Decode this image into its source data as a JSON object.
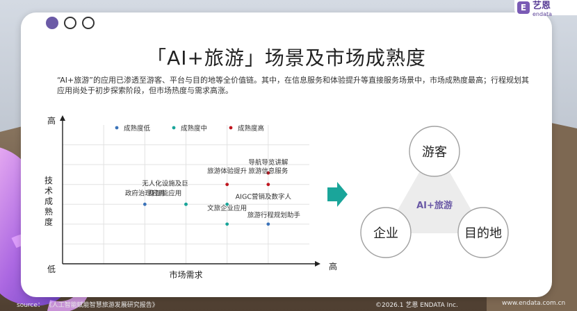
{
  "header": {
    "title": "「AI+旅游」场景及市场成熟度",
    "description": "“AI+旅游”的应用已渗透至游客、平台与目的地等全价值链。其中，在信息服务和体验提升等直接服务场景中，市场成熟度最高；行程规划其应用尚处于初步探索阶段，但市场热度与需求高涨。"
  },
  "logo": {
    "mark": "E",
    "name": "艺恩",
    "sub": "endata"
  },
  "colors": {
    "low": "#3b73b9",
    "mid": "#1aa59a",
    "high": "#c0161f",
    "arrow": "#1aa59a",
    "venn": "#a0a0a0",
    "accent": "#6b5aa6"
  },
  "chart_data": {
    "type": "scatter",
    "xlabel": "市场需求",
    "ylabel": "技术成熟度",
    "x_high_label": "高",
    "y_high_label": "高",
    "origin_label": "低",
    "xlim": [
      0,
      6
    ],
    "ylim": [
      0,
      7
    ],
    "grid": true,
    "legend_position": "top",
    "series": [
      {
        "name": "成熟度低",
        "color_key": "low",
        "points": [
          {
            "label": "政府治理应用",
            "x": 2,
            "y": 3
          },
          {
            "label": "旅游行程规划助手",
            "x": 5,
            "y": 2
          }
        ]
      },
      {
        "name": "成熟度中",
        "color_key": "mid",
        "points": [
          {
            "label": "无人化设施及巨",
            "x": 3,
            "y": 3
          },
          {
            "label": "AIGC营销及数字人",
            "x": 4,
            "y": 3
          },
          {
            "label": "身智能应用",
            "x": 3,
            "y": 3
          },
          {
            "label": "文旅企业应用",
            "x": 4,
            "y": 2
          }
        ]
      },
      {
        "name": "成熟度高",
        "color_key": "high",
        "points": [
          {
            "label": "导航导览讲解",
            "x": 5,
            "y": 5
          },
          {
            "label": "旅游体验提升",
            "x": 4,
            "y": 4
          },
          {
            "label": "旅游信息服务",
            "x": 5,
            "y": 4
          }
        ]
      }
    ]
  },
  "venn": {
    "top": "游客",
    "left": "企业",
    "right": "目的地",
    "center": "AI+旅游"
  },
  "footer": {
    "source": "source： 《人工智能赋能智慧旅游发展研究报告》",
    "copyright": "©2026.1 艺恩 ENDATA Inc.",
    "url": "www.endata.com.cn"
  }
}
